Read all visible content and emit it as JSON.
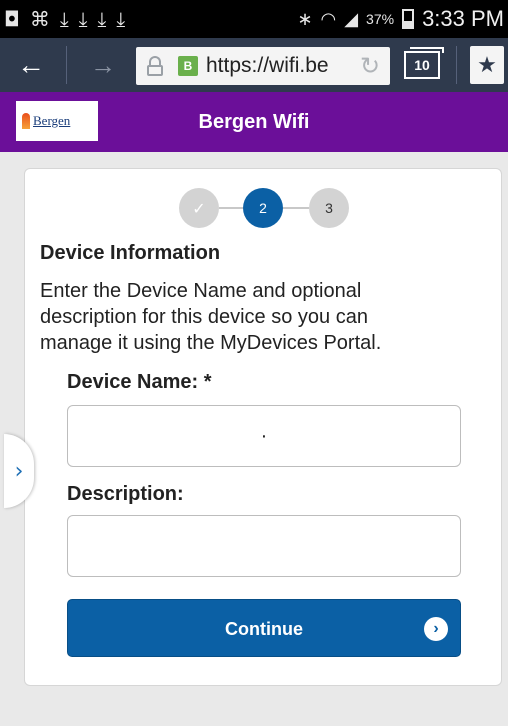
{
  "status_bar": {
    "battery_percent": "37%",
    "time": "3:33 PM"
  },
  "browser": {
    "url": "https://wifi.be",
    "tab_count": "10",
    "favicon_letter": "B"
  },
  "site": {
    "logo_text": "Bergen",
    "title": "Bergen Wifi"
  },
  "wizard": {
    "steps": [
      {
        "label": "✓",
        "state": "done"
      },
      {
        "label": "2",
        "state": "active"
      },
      {
        "label": "3",
        "state": "pending"
      }
    ],
    "section_title": "Device Information",
    "description": "Enter the Device Name and optional description for this device so you can manage it using the MyDevices Portal.",
    "device_name_label": "Device Name: *",
    "device_name_value": "·",
    "description_label": "Description:",
    "description_value": "",
    "continue_label": "Continue"
  },
  "colors": {
    "header_purple": "#6b0f99",
    "primary_blue": "#0b60a5",
    "toolbar_dark": "#2f3a4d"
  }
}
